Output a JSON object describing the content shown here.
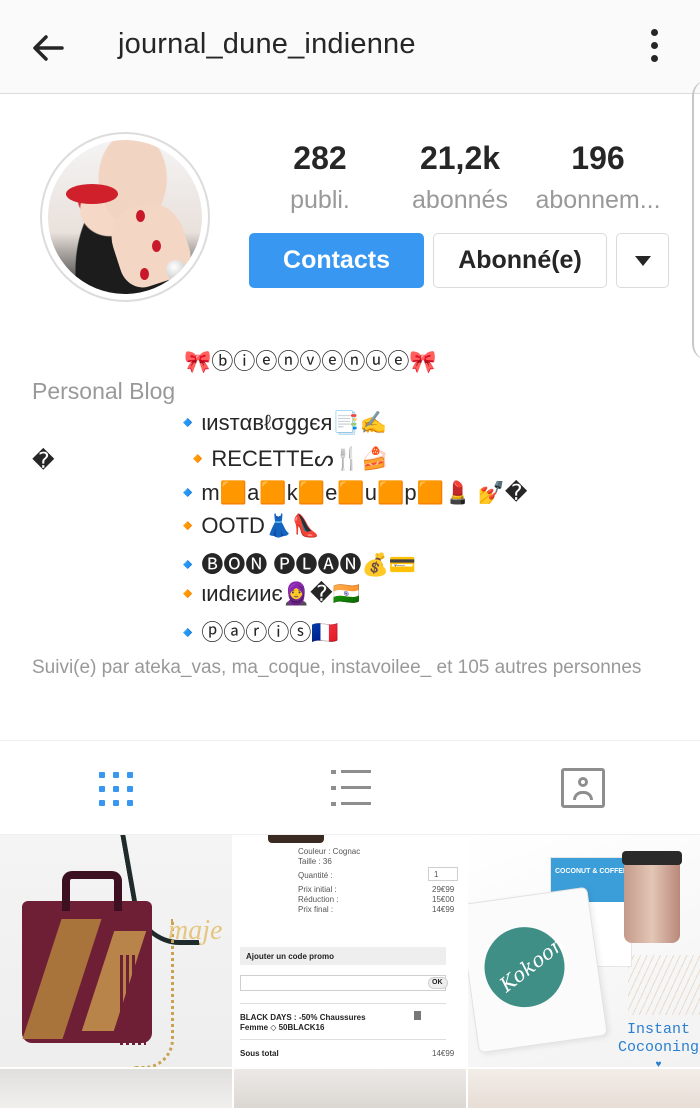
{
  "header": {
    "username": "journal_dune_indienne",
    "back_icon": "arrow-left-icon",
    "menu_icon": "more-vertical-icon"
  },
  "stats": {
    "posts_count": "282",
    "posts_label": "publi.",
    "followers_count": "21,2k",
    "followers_label": "abonnés",
    "following_count": "196",
    "following_label": "abonnem..."
  },
  "actions": {
    "contacts_label": "Contacts",
    "follow_label": "Abonné(e)",
    "dropdown_icon": "caret-down-icon"
  },
  "bio": {
    "welcome": "🎀ⓑⓘⓔⓝⓥⓔⓝⓤⓔ🎀",
    "category": "Personal Blog",
    "line1": "🔹ιиѕтαвℓσggєя📑✍️",
    "line2_left": "�",
    "line2": "🔸RECETTEᔕ🍴🍰",
    "line3": "🔹m🟧a🟧k🟧e🟧u🟧p🟧💄 💅�",
    "line4": "🔸OOTD👗👠",
    "line5": "🔹🅑🅞🅝 🅟🅛🅐🅝💰💳",
    "line6": "🔸ιиdιєииє🧕�🇮🇳",
    "line7": "🔹ⓟⓐⓡⓘⓢ🇫🇷",
    "followed_by": "Suivi(e) par ateka_vas, ma_coque, instavoilee_ et 105 autres personnes"
  },
  "tabs": {
    "grid_icon": "grid-icon",
    "list_icon": "list-icon",
    "tagged_icon": "tagged-person-icon"
  },
  "posts": {
    "p1_text": "maje",
    "receipt": {
      "couleur": "Couleur : Cognac",
      "taille": "Taille : 36",
      "quantite_label": "Quantité :",
      "quantite_value": "1",
      "prix_initial_label": "Prix initial :",
      "prix_initial_value": "29€99",
      "reduction_label": "Réduction :",
      "reduction_value": "15€00",
      "prix_final_label": "Prix final :",
      "prix_final_value": "14€99",
      "promo_label": "Ajouter un code promo",
      "ok_label": "OK",
      "black_days": "BLACK DAYS : -50% Chaussures",
      "black_days_2": "Femme ◇ 50BLACK16",
      "sous_total_label": "Sous total",
      "sous_total_value": "14€99"
    },
    "p3_brand": "Kokoon",
    "p3_box": "COCONUT & COFFEE",
    "p3_line1": "Instant",
    "p3_line2": "Cocooning"
  },
  "colors": {
    "accent": "#3897f0",
    "text": "#262626",
    "muted": "#999999",
    "border": "#dbdbdb"
  }
}
